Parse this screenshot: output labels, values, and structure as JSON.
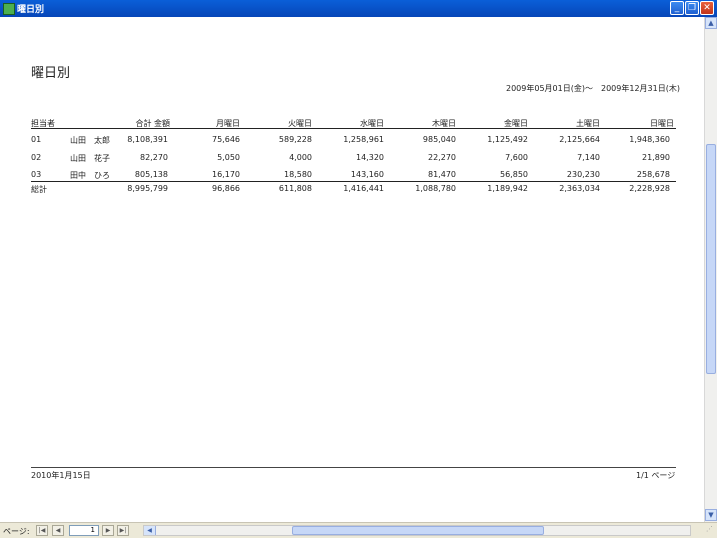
{
  "window": {
    "title": "曜日別",
    "minimize": "_",
    "restore": "❐",
    "close": "✕"
  },
  "report": {
    "title": "曜日別",
    "date_from": "2009年05月01日(金)",
    "tilde": "～",
    "date_to": "2009年12月31日(木)",
    "headers": [
      "担当者",
      "合計 金額",
      "月曜日",
      "火曜日",
      "水曜日",
      "木曜日",
      "金曜日",
      "土曜日",
      "日曜日"
    ],
    "rows": [
      {
        "code": "01",
        "name": "山田　太郎",
        "total": "8,108,391",
        "mon": "75,646",
        "tue": "589,228",
        "wed": "1,258,961",
        "thu": "985,040",
        "fri": "1,125,492",
        "sat": "2,125,664",
        "sun": "1,948,360"
      },
      {
        "code": "02",
        "name": "山田　花子",
        "total": "82,270",
        "mon": "5,050",
        "tue": "4,000",
        "wed": "14,320",
        "thu": "22,270",
        "fri": "7,600",
        "sat": "7,140",
        "sun": "21,890"
      },
      {
        "code": "03",
        "name": "田中　ひろ",
        "total": "805,138",
        "mon": "16,170",
        "tue": "18,580",
        "wed": "143,160",
        "thu": "81,470",
        "fri": "56,850",
        "sat": "230,230",
        "sun": "258,678"
      }
    ],
    "totals": {
      "label": "総計",
      "total": "8,995,799",
      "mon": "96,866",
      "tue": "611,808",
      "wed": "1,416,441",
      "thu": "1,088,780",
      "fri": "1,189,942",
      "sat": "2,363,034",
      "sun": "2,228,928"
    },
    "footer_date": "2010年1月15日",
    "footer_page": "1/1 ページ"
  },
  "statusbar": {
    "page_label": "ページ:",
    "page_value": "1",
    "first": "|◀",
    "prev": "◀",
    "next": "▶",
    "last": "▶|",
    "scroll_left": "◀"
  },
  "scrollbar": {
    "up": "▲",
    "down": "▼"
  }
}
